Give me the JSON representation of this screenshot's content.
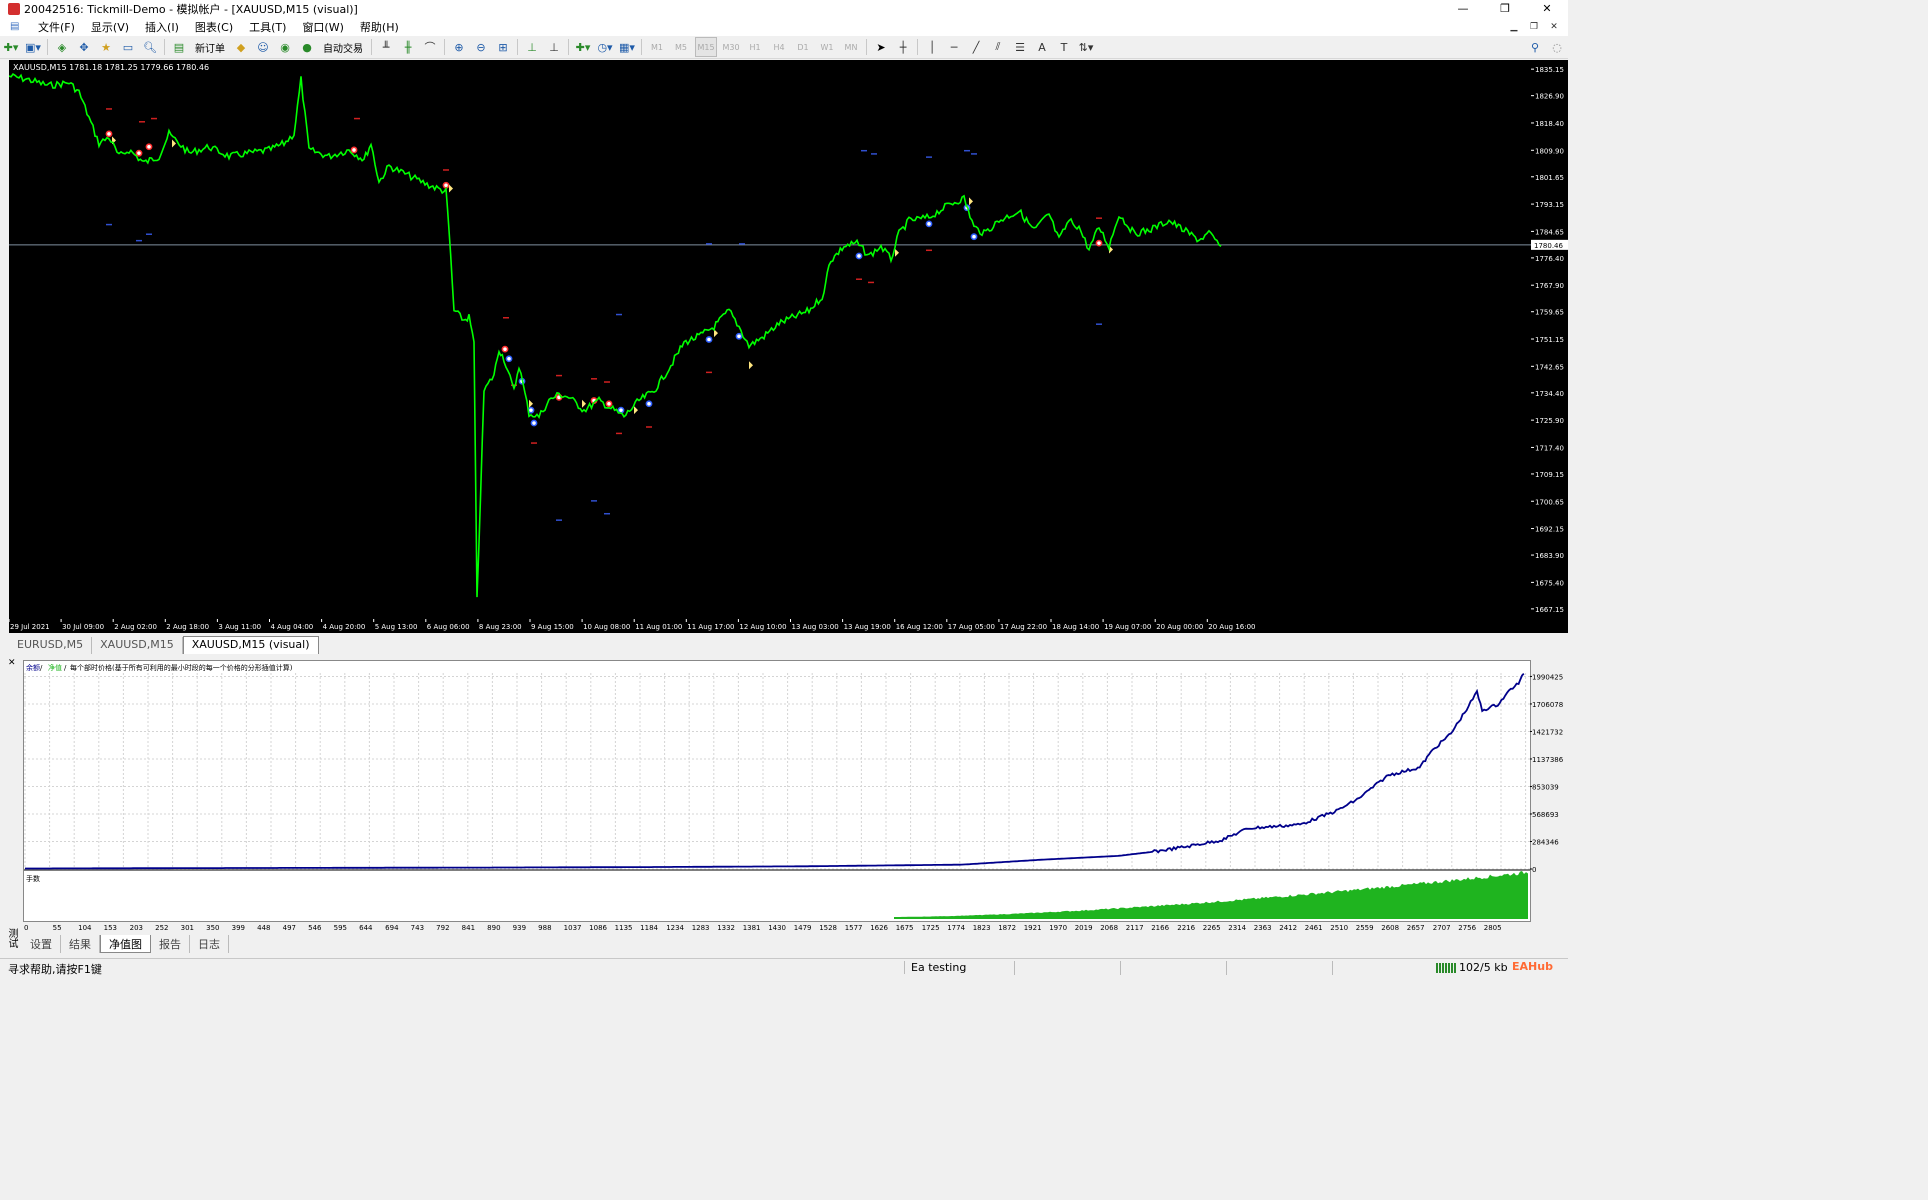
{
  "window": {
    "title": "20042516: Tickmill-Demo - 模拟帐户 - [XAUUSD,M15 (visual)]",
    "controls": [
      "—",
      "❐",
      "✕"
    ]
  },
  "menu": [
    "文件(F)",
    "显示(V)",
    "插入(I)",
    "图表(C)",
    "工具(T)",
    "窗口(W)",
    "帮助(H)"
  ],
  "toolbar": {
    "new_order": "新订单",
    "autotrade": "自动交易",
    "periods": [
      "M1",
      "M5",
      "M15",
      "M30",
      "H1",
      "H4",
      "D1",
      "W1",
      "MN"
    ]
  },
  "chart": {
    "info": "XAUUSD,M15  1781.18 1781.25 1779.66 1780.46",
    "current_price": "1780.46",
    "colors": {
      "background": "#000000",
      "candles": "#00ff00",
      "price_line": "#8090a0",
      "axis_text": "#ffffff"
    },
    "price_ticks": [
      "1835.15",
      "1826.90",
      "1818.40",
      "1809.90",
      "1801.65",
      "1793.15",
      "1784.65",
      "1776.40",
      "1767.90",
      "1759.65",
      "1751.15",
      "1742.65",
      "1734.40",
      "1725.90",
      "1717.40",
      "1709.15",
      "1700.65",
      "1692.15",
      "1683.90",
      "1675.40",
      "1667.15"
    ],
    "time_ticks": [
      "29 Jul 2021",
      "30 Jul 09:00",
      "2 Aug 02:00",
      "2 Aug 18:00",
      "3 Aug 11:00",
      "4 Aug 04:00",
      "4 Aug 20:00",
      "5 Aug 13:00",
      "6 Aug 06:00",
      "8 Aug 23:00",
      "9 Aug 15:00",
      "10 Aug 08:00",
      "11 Aug 01:00",
      "11 Aug 17:00",
      "12 Aug 10:00",
      "13 Aug 03:00",
      "13 Aug 19:00",
      "16 Aug 12:00",
      "17 Aug 05:00",
      "17 Aug 22:00",
      "18 Aug 14:00",
      "19 Aug 07:00",
      "20 Aug 00:00",
      "20 Aug 16:00"
    ],
    "series": [
      [
        0,
        1833
      ],
      [
        18,
        1832
      ],
      [
        40,
        1830
      ],
      [
        60,
        1831
      ],
      [
        70,
        1828
      ],
      [
        80,
        1820
      ],
      [
        90,
        1812
      ],
      [
        100,
        1814
      ],
      [
        110,
        1808
      ],
      [
        120,
        1810
      ],
      [
        135,
        1806
      ],
      [
        150,
        1808
      ],
      [
        160,
        1815
      ],
      [
        170,
        1812
      ],
      [
        180,
        1809
      ],
      [
        200,
        1811
      ],
      [
        220,
        1808
      ],
      [
        240,
        1809
      ],
      [
        260,
        1810
      ],
      [
        275,
        1812
      ],
      [
        285,
        1815
      ],
      [
        292,
        1832
      ],
      [
        300,
        1810
      ],
      [
        320,
        1808
      ],
      [
        340,
        1810
      ],
      [
        355,
        1807
      ],
      [
        362,
        1812
      ],
      [
        370,
        1800
      ],
      [
        380,
        1805
      ],
      [
        400,
        1802
      ],
      [
        420,
        1799
      ],
      [
        437,
        1797
      ],
      [
        440,
        1785
      ],
      [
        445,
        1760
      ],
      [
        455,
        1757
      ],
      [
        460,
        1758
      ],
      [
        465,
        1750
      ],
      [
        468,
        1670
      ],
      [
        475,
        1735
      ],
      [
        485,
        1740
      ],
      [
        490,
        1748
      ],
      [
        495,
        1745
      ],
      [
        505,
        1735
      ],
      [
        510,
        1743
      ],
      [
        520,
        1728
      ],
      [
        530,
        1727
      ],
      [
        540,
        1732
      ],
      [
        550,
        1734
      ],
      [
        560,
        1733
      ],
      [
        575,
        1729
      ],
      [
        590,
        1732
      ],
      [
        600,
        1730
      ],
      [
        615,
        1727
      ],
      [
        630,
        1732
      ],
      [
        645,
        1735
      ],
      [
        660,
        1742
      ],
      [
        675,
        1750
      ],
      [
        690,
        1752
      ],
      [
        705,
        1755
      ],
      [
        720,
        1760
      ],
      [
        730,
        1755
      ],
      [
        740,
        1749
      ],
      [
        755,
        1752
      ],
      [
        770,
        1756
      ],
      [
        785,
        1758
      ],
      [
        800,
        1760
      ],
      [
        815,
        1765
      ],
      [
        820,
        1775
      ],
      [
        835,
        1780
      ],
      [
        848,
        1781
      ],
      [
        860,
        1777
      ],
      [
        872,
        1780
      ],
      [
        882,
        1776
      ],
      [
        890,
        1784
      ],
      [
        900,
        1788
      ],
      [
        920,
        1789
      ],
      [
        940,
        1793
      ],
      [
        955,
        1795
      ],
      [
        965,
        1786
      ],
      [
        975,
        1784
      ],
      [
        990,
        1788
      ],
      [
        1010,
        1791
      ],
      [
        1025,
        1785
      ],
      [
        1040,
        1790
      ],
      [
        1050,
        1782
      ],
      [
        1060,
        1788
      ],
      [
        1070,
        1786
      ],
      [
        1080,
        1779
      ],
      [
        1090,
        1786
      ],
      [
        1100,
        1780
      ],
      [
        1110,
        1790
      ],
      [
        1125,
        1784
      ],
      [
        1140,
        1785
      ],
      [
        1160,
        1788
      ],
      [
        1175,
        1785
      ],
      [
        1190,
        1782
      ],
      [
        1200,
        1784
      ],
      [
        1212,
        1780
      ]
    ],
    "markers": [
      {
        "x": 100,
        "y": 1815,
        "c": "red"
      },
      {
        "x": 130,
        "y": 1809,
        "c": "red"
      },
      {
        "x": 140,
        "y": 1811,
        "c": "red"
      },
      {
        "x": 345,
        "y": 1810,
        "c": "red"
      },
      {
        "x": 437,
        "y": 1799,
        "c": "red"
      },
      {
        "x": 496,
        "y": 1748,
        "c": "red"
      },
      {
        "x": 500,
        "y": 1745,
        "c": "blue"
      },
      {
        "x": 513,
        "y": 1738,
        "c": "blue"
      },
      {
        "x": 522,
        "y": 1729,
        "c": "blue"
      },
      {
        "x": 525,
        "y": 1725,
        "c": "blue"
      },
      {
        "x": 550,
        "y": 1733,
        "c": "red"
      },
      {
        "x": 585,
        "y": 1732,
        "c": "red"
      },
      {
        "x": 600,
        "y": 1731,
        "c": "red"
      },
      {
        "x": 612,
        "y": 1729,
        "c": "blue"
      },
      {
        "x": 640,
        "y": 1731,
        "c": "blue"
      },
      {
        "x": 700,
        "y": 1751,
        "c": "blue"
      },
      {
        "x": 730,
        "y": 1752,
        "c": "blue"
      },
      {
        "x": 850,
        "y": 1777,
        "c": "blue"
      },
      {
        "x": 920,
        "y": 1787,
        "c": "blue"
      },
      {
        "x": 958,
        "y": 1792,
        "c": "blue"
      },
      {
        "x": 965,
        "y": 1783,
        "c": "blue"
      },
      {
        "x": 1090,
        "y": 1781,
        "c": "red"
      },
      {
        "x": 103,
        "y": 1813,
        "c": "yellow"
      },
      {
        "x": 163,
        "y": 1812,
        "c": "yellow"
      },
      {
        "x": 440,
        "y": 1798,
        "c": "yellow"
      },
      {
        "x": 520,
        "y": 1731,
        "c": "yellow"
      },
      {
        "x": 573,
        "y": 1731,
        "c": "yellow"
      },
      {
        "x": 625,
        "y": 1729,
        "c": "yellow"
      },
      {
        "x": 705,
        "y": 1753,
        "c": "yellow"
      },
      {
        "x": 740,
        "y": 1743,
        "c": "yellow"
      },
      {
        "x": 886,
        "y": 1778,
        "c": "yellow"
      },
      {
        "x": 960,
        "y": 1794,
        "c": "yellow"
      },
      {
        "x": 1100,
        "y": 1779,
        "c": "yellow"
      }
    ],
    "dashes": [
      {
        "x": 100,
        "y": 1823,
        "c": "red"
      },
      {
        "x": 133,
        "y": 1819,
        "c": "red"
      },
      {
        "x": 145,
        "y": 1820,
        "c": "red"
      },
      {
        "x": 348,
        "y": 1820,
        "c": "red"
      },
      {
        "x": 437,
        "y": 1804,
        "c": "red"
      },
      {
        "x": 497,
        "y": 1758,
        "c": "red"
      },
      {
        "x": 505,
        "y": 1737,
        "c": "red"
      },
      {
        "x": 525,
        "y": 1719,
        "c": "red"
      },
      {
        "x": 550,
        "y": 1740,
        "c": "red"
      },
      {
        "x": 585,
        "y": 1739,
        "c": "red"
      },
      {
        "x": 598,
        "y": 1738,
        "c": "red"
      },
      {
        "x": 610,
        "y": 1722,
        "c": "red"
      },
      {
        "x": 640,
        "y": 1724,
        "c": "red"
      },
      {
        "x": 700,
        "y": 1741,
        "c": "red"
      },
      {
        "x": 850,
        "y": 1770,
        "c": "red"
      },
      {
        "x": 862,
        "y": 1769,
        "c": "red"
      },
      {
        "x": 920,
        "y": 1779,
        "c": "red"
      },
      {
        "x": 1090,
        "y": 1789,
        "c": "red"
      },
      {
        "x": 100,
        "y": 1787,
        "c": "blue"
      },
      {
        "x": 130,
        "y": 1782,
        "c": "blue"
      },
      {
        "x": 140,
        "y": 1784,
        "c": "blue"
      },
      {
        "x": 855,
        "y": 1810,
        "c": "blue"
      },
      {
        "x": 865,
        "y": 1809,
        "c": "blue"
      },
      {
        "x": 920,
        "y": 1808,
        "c": "blue"
      },
      {
        "x": 958,
        "y": 1810,
        "c": "blue"
      },
      {
        "x": 965,
        "y": 1809,
        "c": "blue"
      },
      {
        "x": 610,
        "y": 1759,
        "c": "blue"
      },
      {
        "x": 550,
        "y": 1695,
        "c": "blue"
      },
      {
        "x": 585,
        "y": 1701,
        "c": "blue"
      },
      {
        "x": 598,
        "y": 1697,
        "c": "blue"
      },
      {
        "x": 700,
        "y": 1781,
        "c": "blue"
      },
      {
        "x": 733,
        "y": 1781,
        "c": "blue"
      },
      {
        "x": 1090,
        "y": 1756,
        "c": "blue"
      }
    ]
  },
  "doc_tabs": [
    "EURUSD,M5",
    "XAUUSD,M15",
    "XAUUSD,M15 (visual)"
  ],
  "tester": {
    "legend_balance": "余额",
    "legend_equity": "净值",
    "legend_rest": "每个部时价格(基于所有可利用的最小时段的每一个价格的分形插值计算)",
    "volume_label": "手数",
    "side_label": "测试",
    "y_ticks": [
      "1990425",
      "1706078",
      "1421732",
      "1137386",
      "853039",
      "568693",
      "284346",
      "0"
    ],
    "x_ticks": [
      "0",
      "55",
      "104",
      "153",
      "203",
      "252",
      "301",
      "350",
      "399",
      "448",
      "497",
      "546",
      "595",
      "644",
      "694",
      "743",
      "792",
      "841",
      "890",
      "939",
      "988",
      "1037",
      "1086",
      "1135",
      "1184",
      "1234",
      "1283",
      "1332",
      "1381",
      "1430",
      "1479",
      "1528",
      "1577",
      "1626",
      "1675",
      "1725",
      "1774",
      "1823",
      "1872",
      "1921",
      "1970",
      "2019",
      "2068",
      "2117",
      "2166",
      "2216",
      "2265",
      "2314",
      "2363",
      "2412",
      "2461",
      "2510",
      "2559",
      "2608",
      "2657",
      "2707",
      "2756",
      "2805"
    ],
    "equity": [
      [
        0,
        5000
      ],
      [
        300,
        9000
      ],
      [
        600,
        12000
      ],
      [
        900,
        15000
      ],
      [
        1200,
        20000
      ],
      [
        1500,
        28000
      ],
      [
        1800,
        45000
      ],
      [
        1950,
        95000
      ],
      [
        2100,
        135000
      ],
      [
        2170,
        180000
      ],
      [
        2230,
        230000
      ],
      [
        2300,
        300000
      ],
      [
        2350,
        420000
      ],
      [
        2450,
        460000
      ],
      [
        2520,
        600000
      ],
      [
        2560,
        720000
      ],
      [
        2620,
        970000
      ],
      [
        2680,
        1050000
      ],
      [
        2705,
        1230000
      ],
      [
        2740,
        1400000
      ],
      [
        2770,
        1650000
      ],
      [
        2790,
        1830000
      ],
      [
        2800,
        1640000
      ],
      [
        2830,
        1700000
      ],
      [
        2855,
        1860000
      ],
      [
        2870,
        1920000
      ],
      [
        2880,
        2020000
      ]
    ],
    "tabs": [
      "设置",
      "结果",
      "净值图",
      "报告",
      "日志"
    ],
    "active_tab": "净值图"
  },
  "status": {
    "help": "寻求帮助,请按F1键",
    "profile": "Ea testing",
    "traffic": "102/5 kb",
    "brand": "EAHub"
  }
}
